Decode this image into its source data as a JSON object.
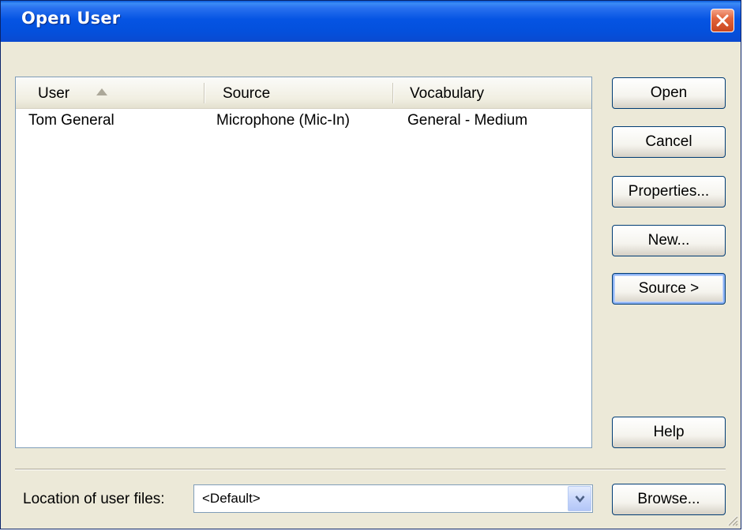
{
  "window": {
    "title": "Open User"
  },
  "list": {
    "columns": [
      {
        "label": "User"
      },
      {
        "label": "Source"
      },
      {
        "label": "Vocabulary"
      }
    ],
    "rows": [
      {
        "user": "Tom General",
        "source": "Microphone (Mic-In)",
        "vocabulary": "General - Medium"
      }
    ]
  },
  "buttons": {
    "open": "Open",
    "cancel": "Cancel",
    "properties": "Properties...",
    "new": "New...",
    "source": "Source >",
    "help": "Help",
    "browse": "Browse..."
  },
  "location": {
    "label": "Location of user files:",
    "value": "<Default>"
  },
  "icons": {
    "close": "close-icon",
    "sort": "sort-ascending-icon",
    "dropdown": "chevron-down-icon",
    "resize": "resize-grip-icon"
  },
  "colors": {
    "titlebar": "#0554e3",
    "window_bg": "#ece9d8",
    "close_button": "#e2653c",
    "focus_ring": "#8cb2f5"
  }
}
